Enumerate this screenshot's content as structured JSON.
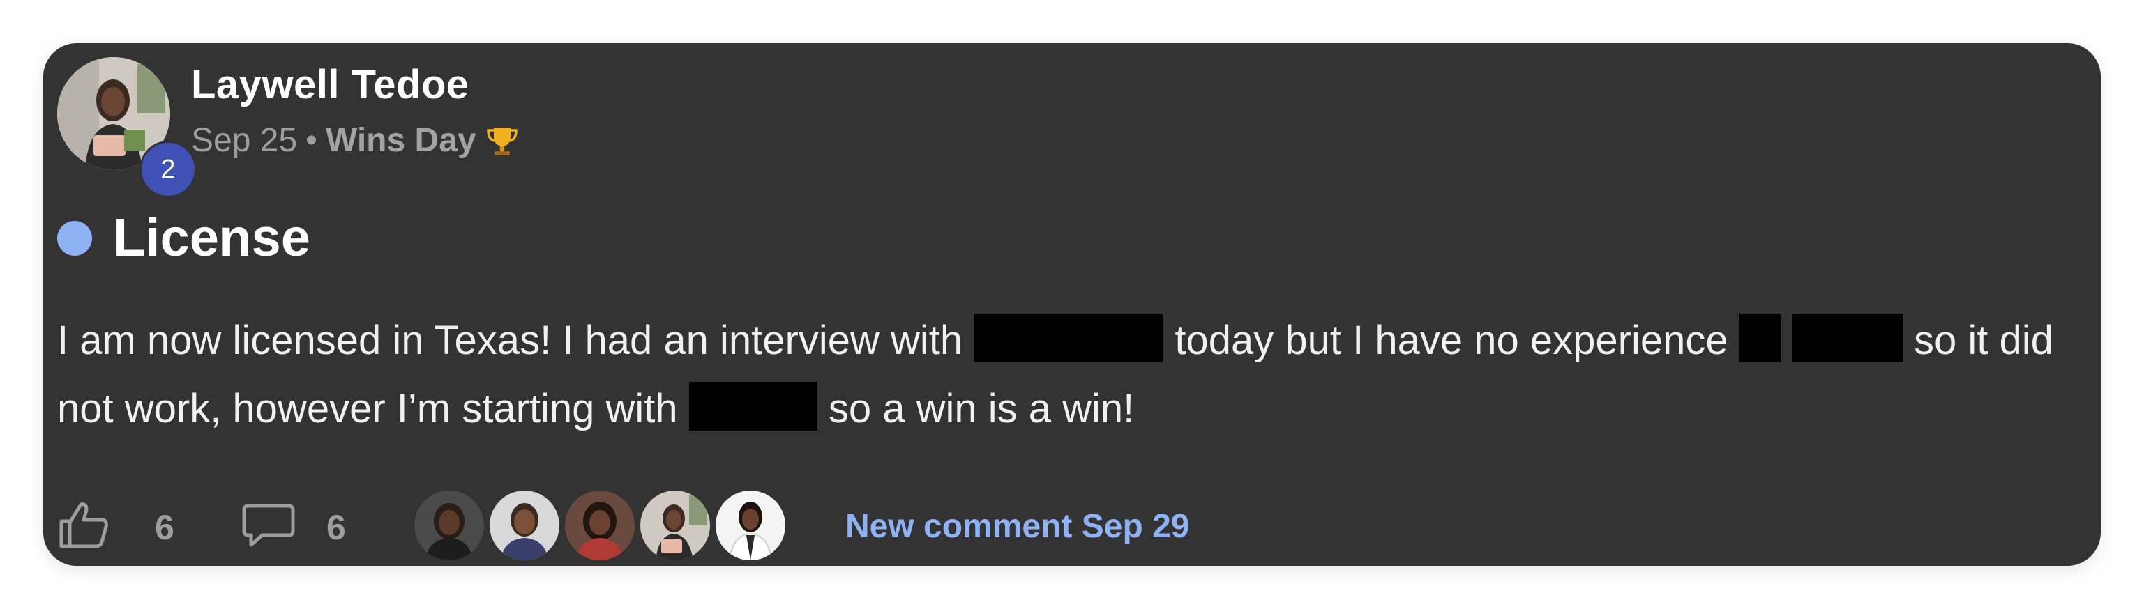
{
  "post": {
    "author": "Laywell Tedoe",
    "level": "2",
    "date": "Sep 25",
    "separator": "•",
    "category": "Wins Day",
    "category_icon": "trophy-icon",
    "title": "License",
    "body": {
      "seg1": "I am now licensed in Texas! I had an interview with ",
      "seg2": " today but I have no experience ",
      "seg3": " so it did not work, however I’m starting with ",
      "seg4": " so a win is a win!"
    }
  },
  "footer": {
    "likes": "6",
    "comments": "6",
    "new_comment": "New comment Sep 29"
  },
  "colors": {
    "card_bg": "#333333",
    "accent": "#8fb2f5",
    "level_badge": "#3f51b5"
  }
}
